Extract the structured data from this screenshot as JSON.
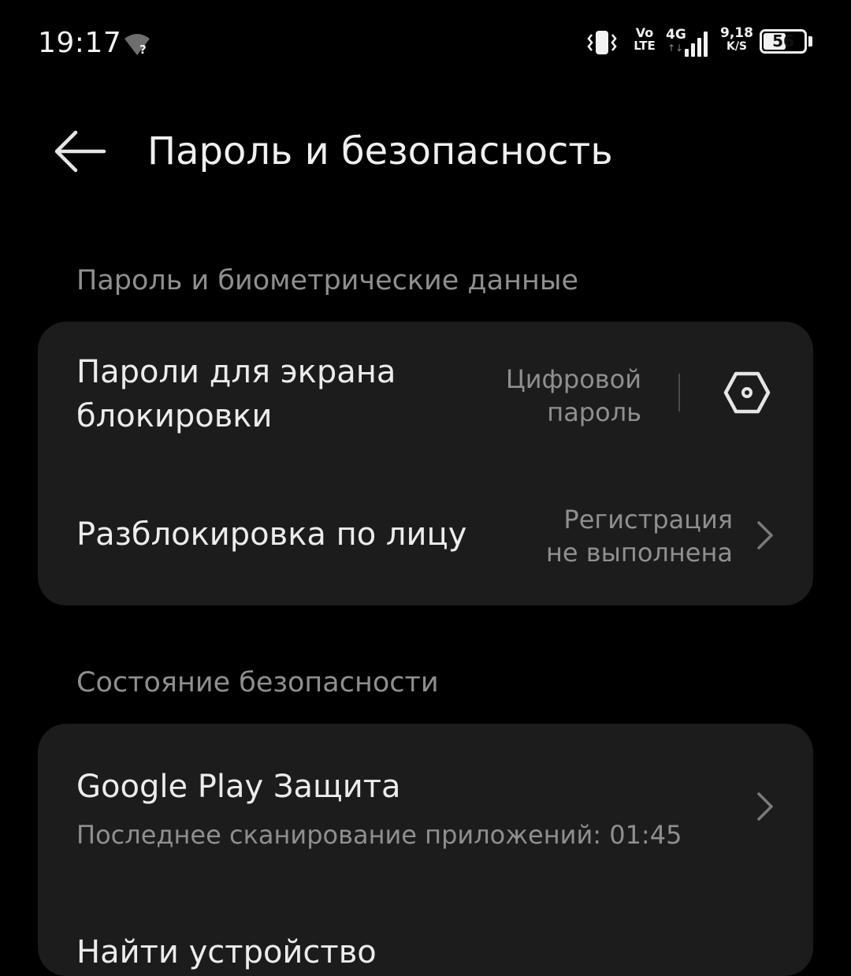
{
  "status_bar": {
    "time": "19:17",
    "wifi_badge": "?",
    "volte_top": "Vo",
    "volte_bottom": "LTE",
    "network_gen": "4G",
    "network_arrows": "↑↓",
    "speed_value": "9,18",
    "speed_unit": "K/S",
    "battery_level": "56",
    "battery_fraction": 0.56,
    "icons": [
      "wifi-question-icon",
      "vibrate-icon",
      "signal-icon",
      "battery-icon"
    ]
  },
  "header": {
    "title": "Пароль и безопасность",
    "back_icon": "arrow-left-icon"
  },
  "sections": {
    "biometrics": {
      "label": "Пароль и биометрические данные",
      "lock_screen": {
        "title_line1": "Пароли для экрана",
        "title_line2": "блокировки",
        "value_line1": "Цифровой",
        "value_line2": "пароль",
        "icon": "hexagon-icon"
      },
      "face_unlock": {
        "title": "Разблокировка по лицу",
        "value_line1": "Регистрация",
        "value_line2": "не выполнена",
        "icon": "chevron-right-icon"
      }
    },
    "security_status": {
      "label": "Состояние безопасности",
      "play_protect": {
        "title": "Google Play Защита",
        "subtitle": "Последнее сканирование приложений: 01:45",
        "icon": "chevron-right-icon"
      },
      "find_device": {
        "title": "Найти устройство"
      }
    }
  },
  "colors": {
    "background": "#000000",
    "card": "#1c1c1c",
    "text_primary": "#ececec",
    "text_secondary": "#8f8f8f"
  }
}
